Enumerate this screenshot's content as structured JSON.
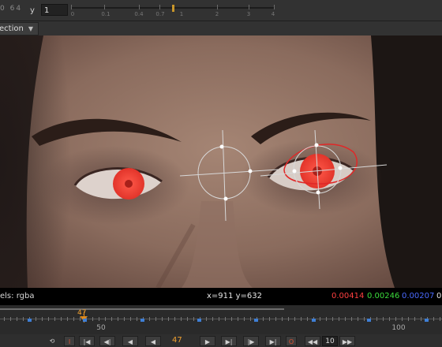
{
  "toolbar": {
    "pre_text": "0 64",
    "y_label": "y",
    "y_value": "1",
    "slider_ticks": [
      "0",
      "0.1",
      "0.4",
      "0.7",
      "1",
      "2",
      "3",
      "4"
    ]
  },
  "channel_dropdown": {
    "label": "ection"
  },
  "info_bar": {
    "channels": "els: rgba",
    "coords": "x=911 y=632",
    "r": "0.00414",
    "g": "0.00246",
    "b": "0.00207",
    "a": "0"
  },
  "timeline": {
    "current_frame": "47",
    "labels": [
      "50",
      "100"
    ]
  },
  "controls": {
    "frame": "47",
    "increment": "10"
  },
  "colors": {
    "accent": "#e08a1a",
    "key": "#3f7fd6"
  }
}
